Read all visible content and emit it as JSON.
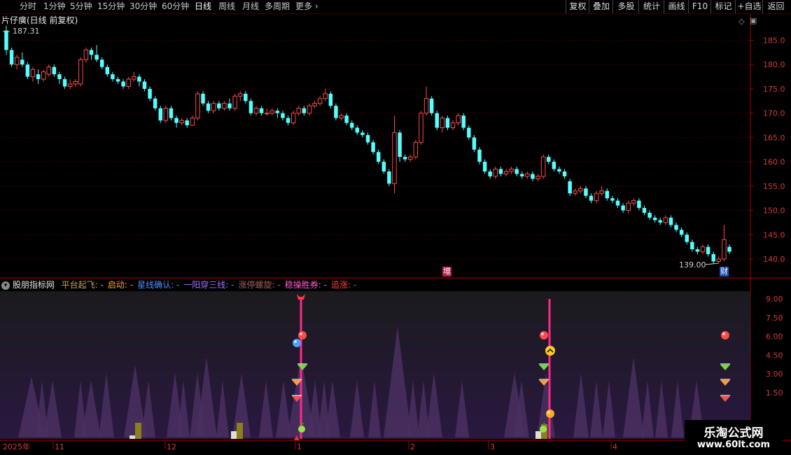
{
  "toolbar": {
    "periods": [
      "分时",
      "1分钟",
      "5分钟",
      "15分钟",
      "30分钟",
      "60分钟",
      "日线",
      "周线",
      "月线",
      "多周期",
      "更多"
    ],
    "active_period": "日线",
    "right_buttons": [
      "复权",
      "叠加",
      "多股",
      "统计",
      "画线",
      "F10",
      "标记",
      "+自选",
      "返回"
    ]
  },
  "main_panel": {
    "title": "片仔癀(日线 前复权)",
    "high_label": "187.31",
    "low_label": "139.00",
    "badge_zeng": "增",
    "badge_cai": "财",
    "y_ticks": [
      "185.0",
      "180.0",
      "175.0",
      "170.0",
      "165.0",
      "160.0",
      "155.0",
      "150.0",
      "145.0",
      "140.0"
    ]
  },
  "indicator_panel": {
    "name": "股朋指标网",
    "items": [
      {
        "label": "平台起飞:",
        "value": "-",
        "color": "#c8a060"
      },
      {
        "label": "启动:",
        "value": "-",
        "color": "#ff9a3a"
      },
      {
        "label": "星线确认:",
        "value": "-",
        "color": "#4f8cff"
      },
      {
        "label": "一阳穿三线:",
        "value": "-",
        "color": "#a070ff"
      },
      {
        "label": "涨停螺旋:",
        "value": "-",
        "color": "#a06060"
      },
      {
        "label": "稳操胜券:",
        "value": "-",
        "color": "#ff5ad0"
      },
      {
        "label": "追涨:",
        "value": "-",
        "color": "#ff4040"
      }
    ],
    "y_ticks": [
      "9.00",
      "7.50",
      "6.00",
      "4.50",
      "3.00",
      "1.50"
    ]
  },
  "time_axis": {
    "labels": [
      "2025年",
      "11",
      "12",
      "1",
      "2",
      "3",
      "4"
    ]
  },
  "brand": {
    "name": "乐淘公式网",
    "url": "www.60lt.com"
  },
  "colors": {
    "up": "#ff4a4a",
    "down": "#54ffff",
    "border": "#b00000",
    "signal_line": "#ff2a8a"
  },
  "chart_data": {
    "type": "candlestick",
    "ylim": [
      137,
      190
    ],
    "candles": [
      [
        187.0,
        183.0,
        188.0,
        182.0
      ],
      [
        183.0,
        180.0,
        183.5,
        179.5
      ],
      [
        180.0,
        181.5,
        182.0,
        179.0
      ],
      [
        181.0,
        180.0,
        182.5,
        179.5
      ],
      [
        180.0,
        177.5,
        180.5,
        177.0
      ],
      [
        177.5,
        179.0,
        179.5,
        176.5
      ],
      [
        178.0,
        177.0,
        179.0,
        176.0
      ],
      [
        177.0,
        178.5,
        179.0,
        176.5
      ],
      [
        178.0,
        179.5,
        180.0,
        177.5
      ],
      [
        179.5,
        178.0,
        180.0,
        177.5
      ],
      [
        178.0,
        177.0,
        178.5,
        176.0
      ],
      [
        177.0,
        175.5,
        177.5,
        175.0
      ],
      [
        175.5,
        176.0,
        177.0,
        175.0
      ],
      [
        176.0,
        176.5,
        177.0,
        175.5
      ],
      [
        176.0,
        181.0,
        181.5,
        175.5
      ],
      [
        181.0,
        183.0,
        183.5,
        180.5
      ],
      [
        183.0,
        182.0,
        183.5,
        181.0
      ],
      [
        182.0,
        181.0,
        184.0,
        180.5
      ],
      [
        181.0,
        179.5,
        181.5,
        179.0
      ],
      [
        179.5,
        178.0,
        180.0,
        177.5
      ],
      [
        178.0,
        177.0,
        178.5,
        176.5
      ],
      [
        177.0,
        176.5,
        177.5,
        176.0
      ],
      [
        176.5,
        175.5,
        177.0,
        175.0
      ],
      [
        175.5,
        177.0,
        177.5,
        175.0
      ],
      [
        177.0,
        177.5,
        178.5,
        176.5
      ],
      [
        177.5,
        176.5,
        178.0,
        175.5
      ],
      [
        176.5,
        175.0,
        177.0,
        174.5
      ],
      [
        175.0,
        173.0,
        175.5,
        172.5
      ],
      [
        173.0,
        171.0,
        173.5,
        170.5
      ],
      [
        171.0,
        168.5,
        171.5,
        168.0
      ],
      [
        168.5,
        171.0,
        171.5,
        168.0
      ],
      [
        171.0,
        169.0,
        171.5,
        168.5
      ],
      [
        169.0,
        168.0,
        169.5,
        167.0
      ],
      [
        168.0,
        168.5,
        169.0,
        167.5
      ],
      [
        168.5,
        167.5,
        169.0,
        167.0
      ],
      [
        167.5,
        169.0,
        169.5,
        167.5
      ],
      [
        169.0,
        174.0,
        174.5,
        168.5
      ],
      [
        174.0,
        172.0,
        174.5,
        171.5
      ],
      [
        172.0,
        170.5,
        172.5,
        170.0
      ],
      [
        170.5,
        172.0,
        172.5,
        170.0
      ],
      [
        172.0,
        171.0,
        172.5,
        170.5
      ],
      [
        171.0,
        172.0,
        172.5,
        170.5
      ],
      [
        172.0,
        171.0,
        173.0,
        170.5
      ],
      [
        171.0,
        173.5,
        174.0,
        170.5
      ],
      [
        173.5,
        174.0,
        174.5,
        172.5
      ],
      [
        174.0,
        172.5,
        174.5,
        172.0
      ],
      [
        172.5,
        170.0,
        173.0,
        169.5
      ],
      [
        170.0,
        171.0,
        171.5,
        169.5
      ],
      [
        171.0,
        170.0,
        171.5,
        169.5
      ],
      [
        170.0,
        170.0,
        171.0,
        169.5
      ],
      [
        170.0,
        170.5,
        171.0,
        169.5
      ],
      [
        170.5,
        170.0,
        171.0,
        169.0
      ],
      [
        170.0,
        169.0,
        170.5,
        168.5
      ],
      [
        169.0,
        168.0,
        169.5,
        167.5
      ],
      [
        168.0,
        170.0,
        170.5,
        167.5
      ],
      [
        170.0,
        171.0,
        171.5,
        169.5
      ],
      [
        171.0,
        170.0,
        171.5,
        169.5
      ],
      [
        170.0,
        171.5,
        172.0,
        169.5
      ],
      [
        171.5,
        172.0,
        172.5,
        171.0
      ],
      [
        172.0,
        173.0,
        173.5,
        171.5
      ],
      [
        173.0,
        174.0,
        175.0,
        172.5
      ],
      [
        174.0,
        171.5,
        174.5,
        171.0
      ],
      [
        171.5,
        169.0,
        172.0,
        168.5
      ],
      [
        169.0,
        169.5,
        170.0,
        168.5
      ],
      [
        169.5,
        168.0,
        170.0,
        167.5
      ],
      [
        168.0,
        167.0,
        168.5,
        166.5
      ],
      [
        167.0,
        166.0,
        167.5,
        165.5
      ],
      [
        166.0,
        165.5,
        166.5,
        165.0
      ],
      [
        165.5,
        164.0,
        166.0,
        163.5
      ],
      [
        164.0,
        162.0,
        164.5,
        161.5
      ],
      [
        162.0,
        160.0,
        162.5,
        159.5
      ],
      [
        160.0,
        158.0,
        160.5,
        157.5
      ],
      [
        158.0,
        155.5,
        158.5,
        155.0
      ],
      [
        155.5,
        166.0,
        169.5,
        153.5
      ],
      [
        166.0,
        161.0,
        166.5,
        160.0
      ],
      [
        161.0,
        160.5,
        161.5,
        160.0
      ],
      [
        160.5,
        161.0,
        161.5,
        160.0
      ],
      [
        161.0,
        164.0,
        164.5,
        160.5
      ],
      [
        164.0,
        170.0,
        170.5,
        163.5
      ],
      [
        170.0,
        173.0,
        175.5,
        169.5
      ],
      [
        173.0,
        170.0,
        173.5,
        169.5
      ],
      [
        170.0,
        167.0,
        170.5,
        166.5
      ],
      [
        167.0,
        169.0,
        169.5,
        166.0
      ],
      [
        169.0,
        167.0,
        169.5,
        166.5
      ],
      [
        167.0,
        168.0,
        168.5,
        166.5
      ],
      [
        168.0,
        169.5,
        170.0,
        167.5
      ],
      [
        169.5,
        167.0,
        170.0,
        166.5
      ],
      [
        167.0,
        165.0,
        167.5,
        164.5
      ],
      [
        165.0,
        162.5,
        165.5,
        162.0
      ],
      [
        162.5,
        160.0,
        163.0,
        159.5
      ],
      [
        160.0,
        158.0,
        160.5,
        157.5
      ],
      [
        158.0,
        157.0,
        158.5,
        156.5
      ],
      [
        157.0,
        158.5,
        159.0,
        156.5
      ],
      [
        158.5,
        157.5,
        159.0,
        157.0
      ],
      [
        157.5,
        158.0,
        158.5,
        157.0
      ],
      [
        158.0,
        158.5,
        159.0,
        157.5
      ],
      [
        158.5,
        157.5,
        159.0,
        157.0
      ],
      [
        157.5,
        157.0,
        158.0,
        156.5
      ],
      [
        157.0,
        157.5,
        158.0,
        156.5
      ],
      [
        157.5,
        156.5,
        158.0,
        156.0
      ],
      [
        156.5,
        157.0,
        157.5,
        156.0
      ],
      [
        157.0,
        161.0,
        161.5,
        156.5
      ],
      [
        161.0,
        160.0,
        161.5,
        159.5
      ],
      [
        160.0,
        158.5,
        160.5,
        158.0
      ],
      [
        158.5,
        158.0,
        159.0,
        157.5
      ],
      [
        158.0,
        157.0,
        158.5,
        156.5
      ],
      [
        156.0,
        153.5,
        156.5,
        153.0
      ],
      [
        153.5,
        154.0,
        154.5,
        153.0
      ],
      [
        154.0,
        154.5,
        155.0,
        153.5
      ],
      [
        154.5,
        153.0,
        155.0,
        152.5
      ],
      [
        153.0,
        152.0,
        153.5,
        151.5
      ],
      [
        152.0,
        153.5,
        154.0,
        151.5
      ],
      [
        153.5,
        154.0,
        155.0,
        153.0
      ],
      [
        154.0,
        152.5,
        154.5,
        152.0
      ],
      [
        152.5,
        152.0,
        153.0,
        151.5
      ],
      [
        152.0,
        151.0,
        152.5,
        150.5
      ],
      [
        151.0,
        150.0,
        151.5,
        149.5
      ],
      [
        150.0,
        151.5,
        152.0,
        149.5
      ],
      [
        151.5,
        152.0,
        152.5,
        151.0
      ],
      [
        152.0,
        150.5,
        152.5,
        150.0
      ],
      [
        150.5,
        149.5,
        151.0,
        149.0
      ],
      [
        149.5,
        148.5,
        150.0,
        148.0
      ],
      [
        148.5,
        148.0,
        149.0,
        147.5
      ],
      [
        148.0,
        147.5,
        148.5,
        147.0
      ],
      [
        147.5,
        148.5,
        149.0,
        147.0
      ],
      [
        148.5,
        147.0,
        149.0,
        146.5
      ],
      [
        147.0,
        146.0,
        147.5,
        145.5
      ],
      [
        146.0,
        145.0,
        146.5,
        144.5
      ],
      [
        145.0,
        143.5,
        145.5,
        143.0
      ],
      [
        143.5,
        142.0,
        144.0,
        141.5
      ],
      [
        142.0,
        141.5,
        142.5,
        141.0
      ],
      [
        141.5,
        142.5,
        143.0,
        141.0
      ],
      [
        142.5,
        141.0,
        143.0,
        140.5
      ],
      [
        141.0,
        139.5,
        141.5,
        139.0
      ],
      [
        139.5,
        140.0,
        140.5,
        139.0
      ],
      [
        140.0,
        144.0,
        147.0,
        139.5
      ],
      [
        142.5,
        141.5,
        143.0,
        141.0
      ]
    ],
    "indicator_peaks": [
      [
        4.5,
        45,
        38
      ],
      [
        4,
        60,
        18
      ],
      [
        4,
        75,
        26
      ],
      [
        4,
        115,
        18
      ],
      [
        4,
        130,
        28
      ],
      [
        5,
        152,
        22
      ],
      [
        6,
        193,
        32
      ],
      [
        4,
        212,
        20
      ],
      [
        5,
        250,
        24
      ],
      [
        4,
        262,
        18
      ],
      [
        5,
        282,
        22
      ],
      [
        7,
        295,
        30
      ],
      [
        4,
        318,
        18
      ],
      [
        5,
        345,
        26
      ],
      [
        4,
        380,
        20
      ],
      [
        4,
        405,
        22
      ],
      [
        7,
        430,
        40
      ],
      [
        4,
        450,
        20
      ],
      [
        4,
        463,
        18
      ],
      [
        4,
        475,
        22
      ],
      [
        4,
        510,
        20
      ],
      [
        4,
        535,
        18
      ],
      [
        11,
        568,
        40
      ],
      [
        4,
        590,
        18
      ],
      [
        4,
        605,
        18
      ],
      [
        5,
        620,
        24
      ],
      [
        4,
        660,
        20
      ],
      [
        5,
        735,
        30
      ],
      [
        4,
        745,
        22
      ],
      [
        5,
        780,
        26
      ],
      [
        5,
        830,
        22
      ],
      [
        4,
        852,
        18
      ],
      [
        4,
        870,
        18
      ],
      [
        7,
        905,
        30
      ],
      [
        4,
        925,
        18
      ],
      [
        4,
        945,
        18
      ],
      [
        4,
        968,
        18
      ],
      [
        4,
        995,
        22
      ]
    ],
    "signal_lines": [
      430,
      785
    ]
  }
}
